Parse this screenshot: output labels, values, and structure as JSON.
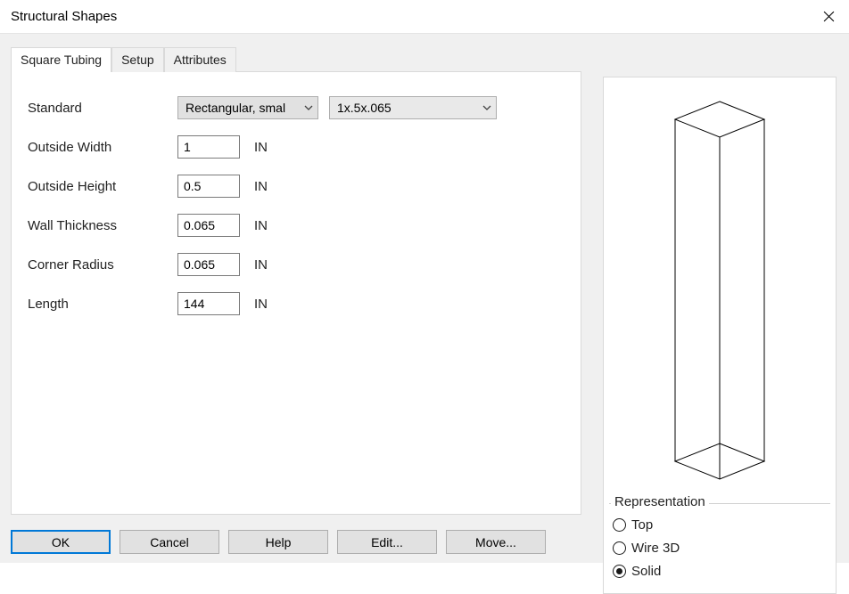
{
  "dialog": {
    "title": "Structural Shapes"
  },
  "tabs": [
    {
      "label": "Square Tubing",
      "active": true
    },
    {
      "label": "Setup",
      "active": false
    },
    {
      "label": "Attributes",
      "active": false
    }
  ],
  "form": {
    "standard_label": "Standard",
    "standard_select1": "Rectangular, smal",
    "standard_select2": "1x.5x.065",
    "unit": "IN",
    "fields": [
      {
        "label": "Outside Width",
        "value": "1"
      },
      {
        "label": "Outside Height",
        "value": "0.5"
      },
      {
        "label": "Wall Thickness",
        "value": "0.065"
      },
      {
        "label": "Corner Radius",
        "value": "0.065"
      },
      {
        "label": "Length",
        "value": "144"
      }
    ]
  },
  "buttons": {
    "ok": "OK",
    "cancel": "Cancel",
    "help": "Help",
    "edit": "Edit...",
    "move": "Move..."
  },
  "representation": {
    "legend": "Representation",
    "options": [
      {
        "label": "Top",
        "selected": false
      },
      {
        "label": "Wire 3D",
        "selected": false
      },
      {
        "label": "Solid",
        "selected": true
      }
    ]
  }
}
